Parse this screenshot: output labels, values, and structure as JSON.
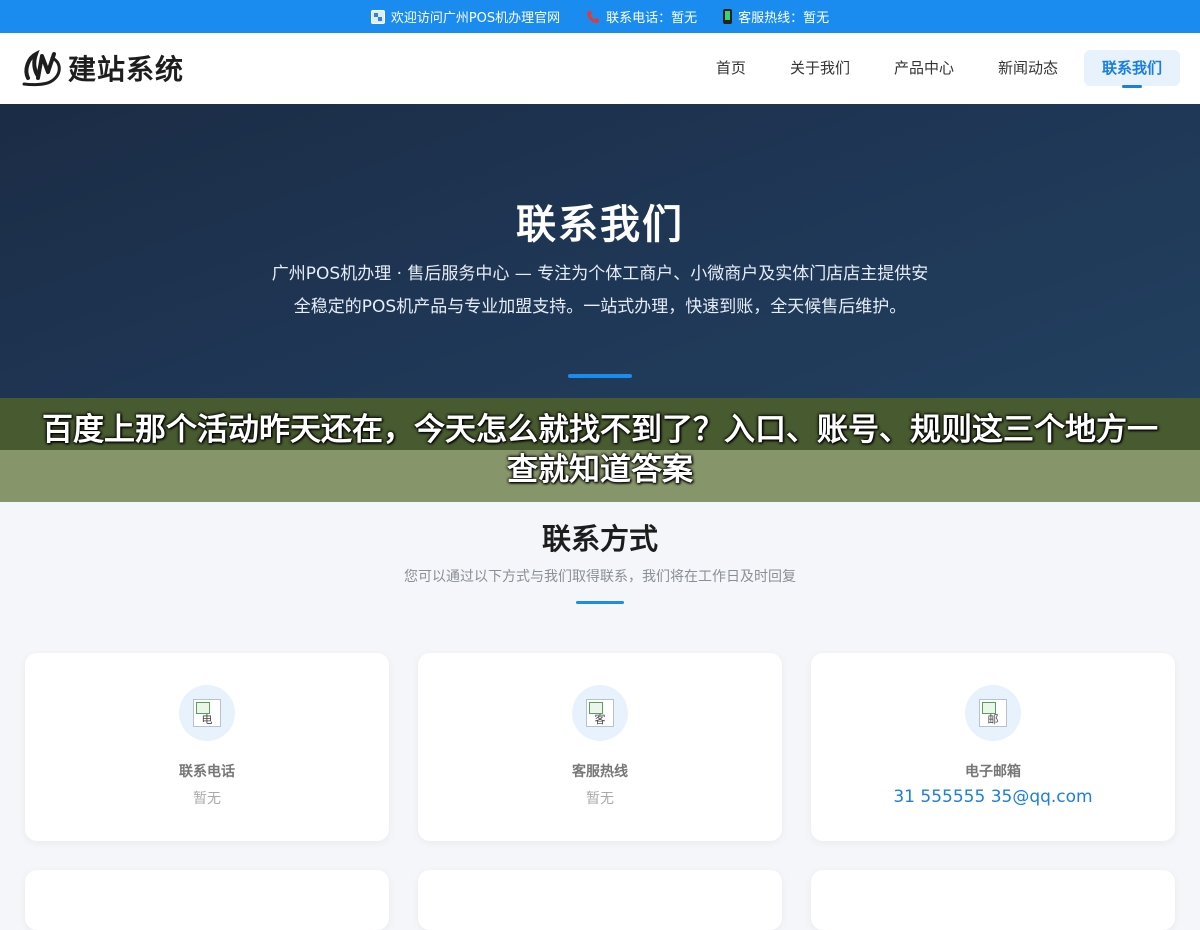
{
  "topbar": {
    "welcome": "欢迎访问广州POS机办理官网",
    "phone": "联系电话：暂无",
    "hotline": "客服热线：暂无"
  },
  "header": {
    "logo_text": "建站系统",
    "nav": [
      {
        "label": "首页",
        "active": false
      },
      {
        "label": "关于我们",
        "active": false
      },
      {
        "label": "产品中心",
        "active": false
      },
      {
        "label": "新闻动态",
        "active": false
      },
      {
        "label": "联系我们",
        "active": true
      }
    ]
  },
  "hero": {
    "title": "联系我们",
    "description": "广州POS机办理 · 售后服务中心 — 专注为个体工商户、小微商户及实体门店店主提供安全稳定的POS机产品与专业加盟支持。一站式办理，快速到账，全天候售后维护。"
  },
  "banner": {
    "text": "百度上那个活动昨天还在，今天怎么就找不到了？入口、账号、规则这三个地方一查就知道答案"
  },
  "contact": {
    "title": "联系方式",
    "subtitle": "您可以通过以下方式与我们取得联系，我们将在工作日及时回复",
    "cards": [
      {
        "icon_alt": "电",
        "label": "联系电话",
        "value": "暂无"
      },
      {
        "icon_alt": "客",
        "label": "客服热线",
        "value": "暂无"
      },
      {
        "icon_alt": "邮",
        "label": "电子邮箱",
        "value": "31 555555 35@qq.com"
      }
    ]
  },
  "colors": {
    "accent": "#1a8cf0",
    "hero_bg": "#1f3756",
    "banner_top": "#485a30",
    "banner_bottom": "#87956a"
  }
}
